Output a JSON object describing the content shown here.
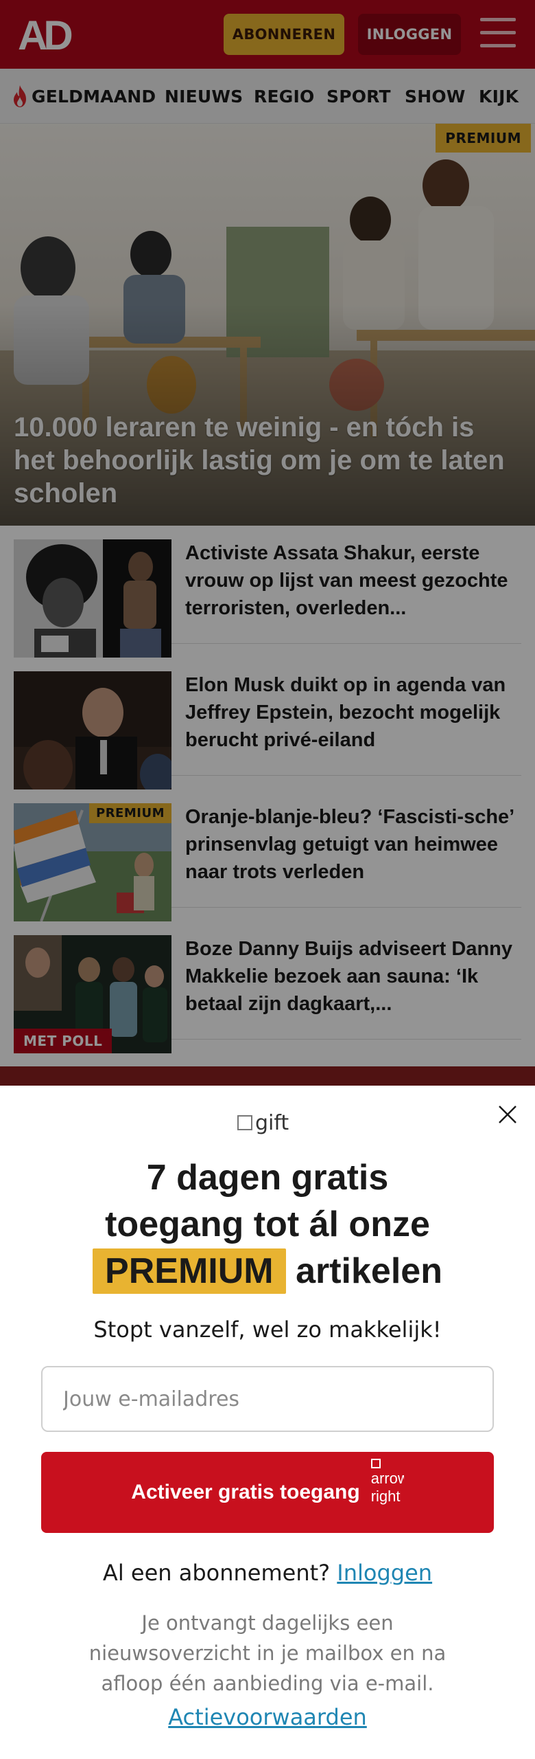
{
  "brand": {
    "logo_text": "AD",
    "accent": "#b2071a",
    "premium_color": "#e8b331",
    "link_color": "#1f86b3"
  },
  "header": {
    "subscribe_label": "ABONNEREN",
    "login_label": "INLOGGEN",
    "menu_icon": "hamburger-icon"
  },
  "nav": {
    "items": [
      {
        "label": "GELDMAAND",
        "icon": "flame-icon"
      },
      {
        "label": "NIEUWS"
      },
      {
        "label": "REGIO"
      },
      {
        "label": "SPORT"
      },
      {
        "label": "SHOW"
      },
      {
        "label": "KIJK"
      }
    ]
  },
  "hero": {
    "badge": "PREMIUM",
    "title": "10.000 leraren te weinig - en tóch is het behoorlijk lastig om je om te laten scholen"
  },
  "articles": [
    {
      "headline": "Activiste Assata Shakur, eerste vrouw op lijst van meest gezochte terroristen, overleden..."
    },
    {
      "headline": "Elon Musk duikt op in agenda van Jeffrey Epstein, bezocht mogelijk berucht privé-eiland"
    },
    {
      "headline": "Oranje-blanje-bleu? ‘Fascisti-sche’ prinsenvlag getuigt van heimwee naar trots verleden",
      "badge": "PREMIUM"
    },
    {
      "headline": "Boze Danny Buijs adviseert Danny Makkelie bezoek aan sauna: ‘Ik betaal zijn dagkaart,...",
      "badge": "MET POLL"
    }
  ],
  "modal": {
    "gift_alt": "gift",
    "title_line1": "7 dagen gratis",
    "title_line2": "toegang tot ál onze",
    "premium_word": "PREMIUM",
    "title_line3_rest": "artikelen",
    "subtitle": "Stopt vanzelf, wel zo makkelijk!",
    "email_placeholder": "Jouw e-mailadres",
    "cta_label": "Activeer gratis toegang",
    "cta_icon_alt": "arrow right",
    "login_prompt": "Al een abonnement?",
    "login_link": "Inloggen",
    "info_text": "Je ontvangt dagelijks een nieuwsoverzicht in je mailbox en na afloop één aanbieding via e-mail.",
    "terms_link": "Actievoorwaarden"
  }
}
